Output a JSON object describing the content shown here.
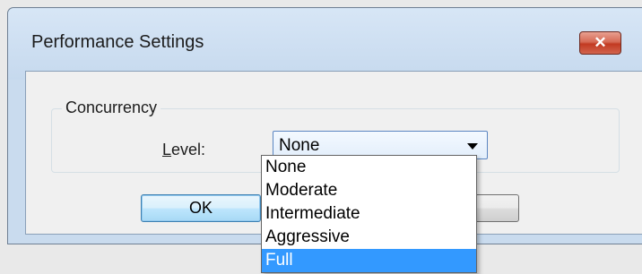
{
  "dialog": {
    "title": "Performance Settings",
    "close_label": "✕"
  },
  "group": {
    "legend": "Concurrency",
    "level_label": "Level:",
    "level_access_key": "L"
  },
  "combo": {
    "value": "None"
  },
  "buttons": {
    "ok": "OK",
    "cancel": ""
  },
  "dropdown": {
    "options": [
      "None",
      "Moderate",
      "Intermediate",
      "Aggressive",
      "Full"
    ],
    "highlighted": "Full"
  },
  "colors": {
    "highlight": "#3399ff",
    "close_button": "#c23a22"
  }
}
